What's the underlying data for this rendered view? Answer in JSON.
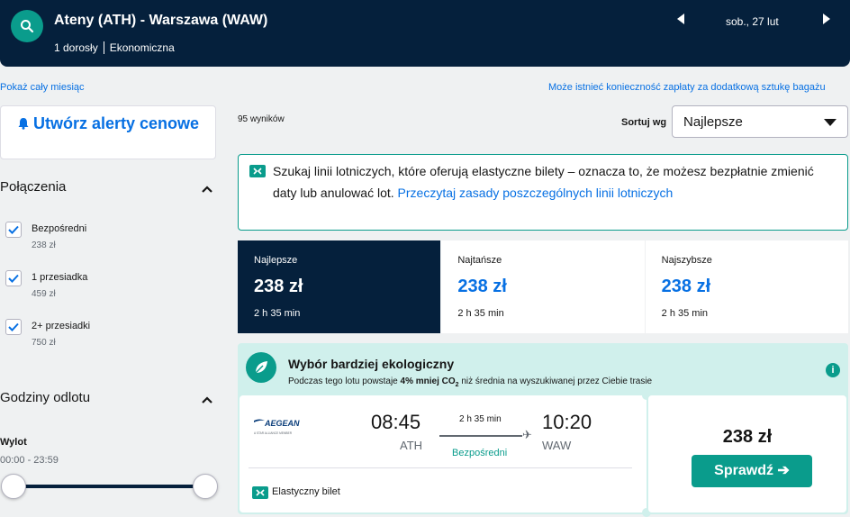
{
  "header": {
    "route": "Ateny (ATH) - Warszawa (WAW)",
    "passengers": "1 dorosły",
    "cabin": "Ekonomiczna",
    "date": "sob., 27 lut"
  },
  "links": {
    "whole_month": "Pokaż cały miesiąc",
    "baggage": "Może istnieć konieczność zapłaty za dodatkową sztukę bagażu"
  },
  "sidebar": {
    "alert_button": "Utwórz alerty cenowe",
    "connections_title": "Połączenia",
    "stops": [
      {
        "label": "Bezpośredni",
        "price": "238 zł",
        "checked": true
      },
      {
        "label": "1 przesiadka",
        "price": "459 zł",
        "checked": true
      },
      {
        "label": "2+ przesiadki",
        "price": "750 zł",
        "checked": true
      }
    ],
    "departure_times_title": "Godziny odlotu",
    "outbound_label": "Wylot",
    "outbound_range": "00:00 - 23:59"
  },
  "main": {
    "results_count": "95 wyników",
    "sort_label": "Sortuj wg",
    "sort_value": "Najlepsze",
    "info_text": "Szukaj linii lotniczych, które oferują elastyczne bilety – oznacza to, że możesz bezpłatnie zmienić daty lub anulować lot.",
    "info_link": "Przeczytaj zasady poszczególnych linii lotniczych",
    "tabs": [
      {
        "label": "Najlepsze",
        "price": "238 zł",
        "duration": "2 h 35 min"
      },
      {
        "label": "Najtańsze",
        "price": "238 zł",
        "duration": "2 h 35 min"
      },
      {
        "label": "Najszybsze",
        "price": "238 zł",
        "duration": "2 h 35 min"
      }
    ]
  },
  "eco_card": {
    "title": "Wybór bardziej ekologiczny",
    "desc_prefix": "Podczas tego lotu powstaje ",
    "desc_bold": "4% mniej CO",
    "desc_sub": "2",
    "desc_suffix": " niż średnia na wyszukiwanej przez Ciebie trasie",
    "info_glyph": "i"
  },
  "flight": {
    "airline": "AEGEAN",
    "airline_tagline": "A STAR ALLIANCE MEMBER",
    "dep_time": "08:45",
    "dep_code": "ATH",
    "duration": "2 h 35 min",
    "stops": "Bezpośredni",
    "arr_time": "10:20",
    "arr_code": "WAW",
    "flexible": "Elastyczny bilet",
    "price": "238 zł",
    "select_button": "Sprawdź ➔"
  },
  "colors": {
    "navy": "#05203c",
    "teal": "#0a9c8c",
    "blue": "#0770e3",
    "eco_bg": "#d0f0ec"
  }
}
